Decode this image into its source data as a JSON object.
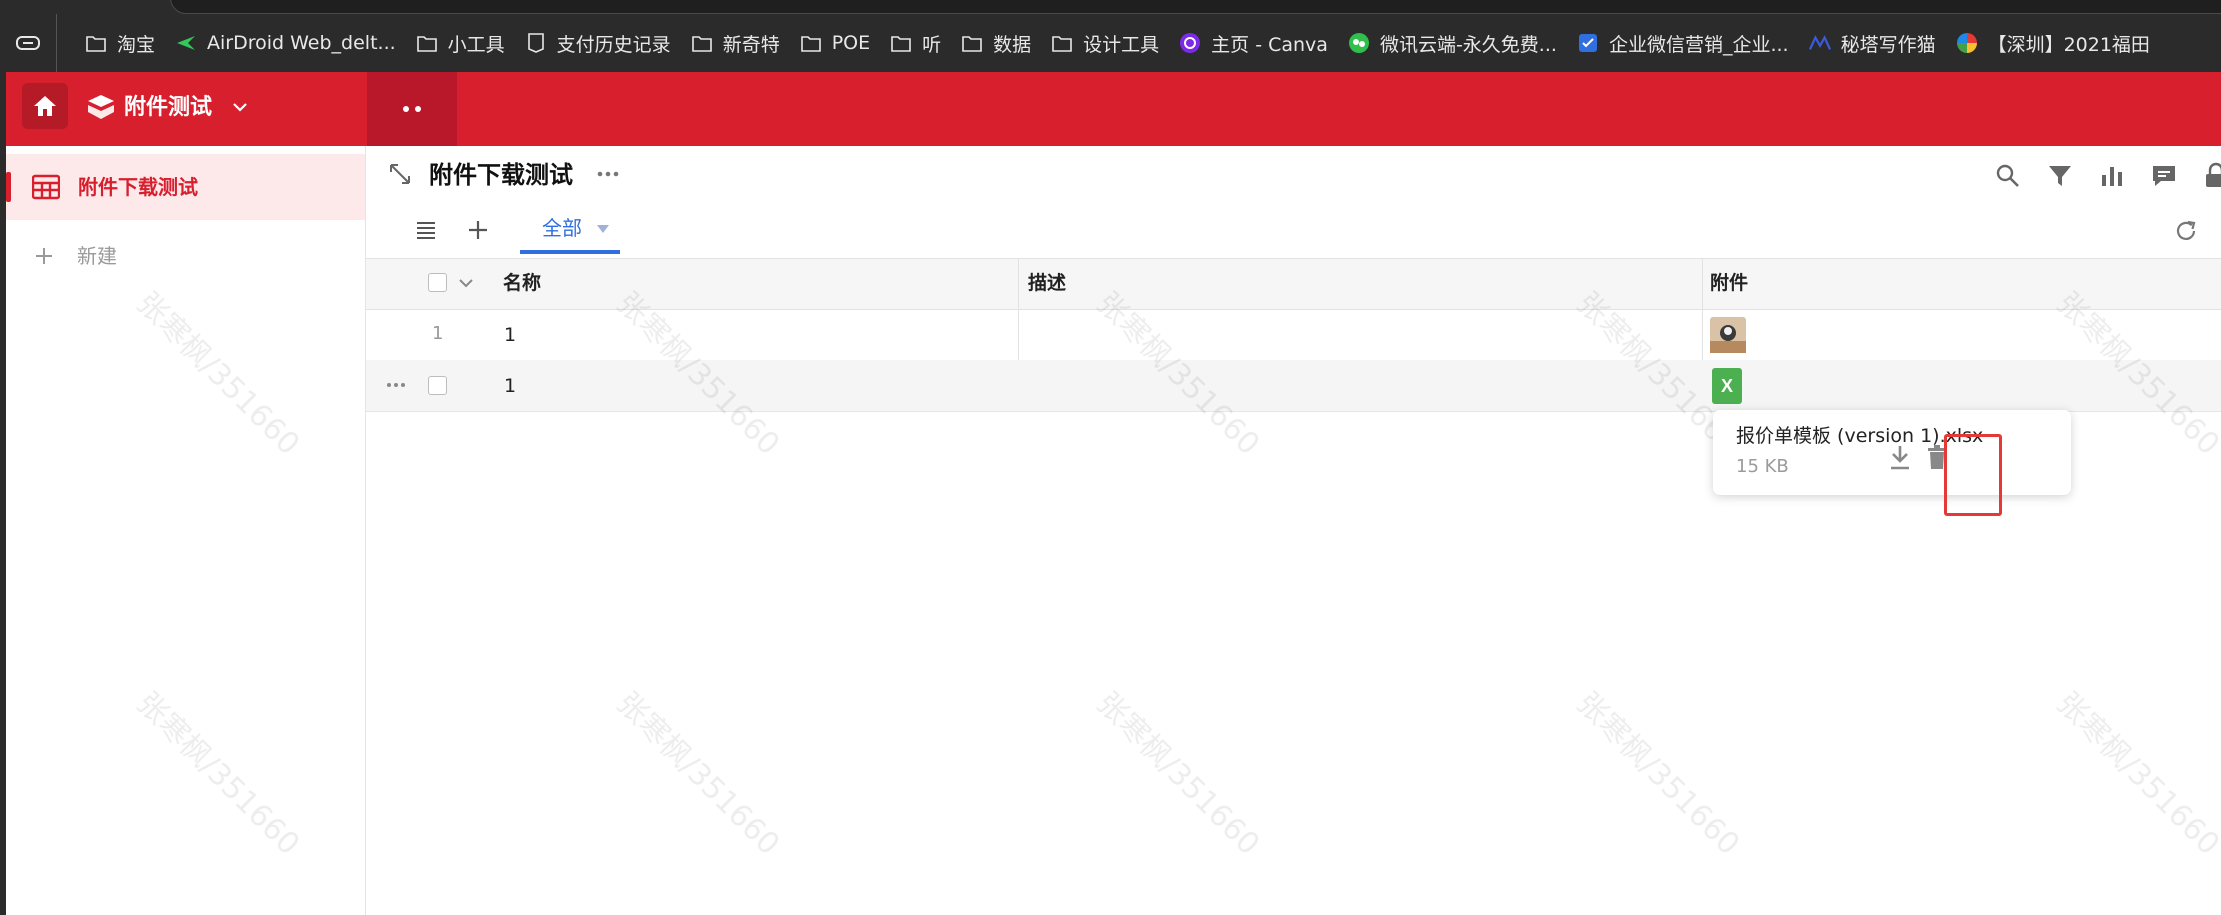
{
  "browser": {
    "bookmarks": [
      {
        "label": "淘宝",
        "icon": "folder-icon"
      },
      {
        "label": "AirDroid Web_delt...",
        "icon": "airdroid-icon"
      },
      {
        "label": "小工具",
        "icon": "folder-icon"
      },
      {
        "label": "支付历史记录",
        "icon": "epic-icon"
      },
      {
        "label": "新奇特",
        "icon": "folder-icon"
      },
      {
        "label": "POE",
        "icon": "folder-icon"
      },
      {
        "label": "听",
        "icon": "folder-icon"
      },
      {
        "label": "数据",
        "icon": "folder-icon"
      },
      {
        "label": "设计工具",
        "icon": "folder-icon"
      },
      {
        "label": "主页 - Canva",
        "icon": "canva-icon"
      },
      {
        "label": "微讯云端-永久免费...",
        "icon": "wechat-cloud-icon"
      },
      {
        "label": "企业微信营销_企业...",
        "icon": "checkbox-icon"
      },
      {
        "label": "秘塔写作猫",
        "icon": "metaso-icon"
      },
      {
        "label": "【深圳】2021福田",
        "icon": "pinwheel-icon"
      }
    ]
  },
  "app": {
    "title": "附件测试",
    "colors": {
      "brand": "#d71f2e",
      "accent": "#2f6fe0",
      "excel": "#4caf50"
    }
  },
  "sidebar": {
    "items": [
      {
        "label": "附件下载测试",
        "icon": "table-icon",
        "active": true
      }
    ],
    "new_label": "新建"
  },
  "main": {
    "title": "附件下载测试",
    "toolbar_icons": [
      "search-icon",
      "filter-icon",
      "chart-icon",
      "comment-icon",
      "lock-icon"
    ],
    "view_tab": {
      "label": "全部"
    }
  },
  "grid": {
    "columns": [
      "名称",
      "描述",
      "附件"
    ],
    "rows": [
      {
        "index": "1",
        "name": "1",
        "description": "",
        "attachment": "image-thumbnail"
      },
      {
        "index": "",
        "name": "1",
        "description": "",
        "attachment": "excel-file"
      }
    ]
  },
  "popover": {
    "file_name": "报价单模板 (version 1).xlsx",
    "file_size": "15 KB",
    "excel_badge": "X"
  },
  "watermark": "张寒枫/351660"
}
